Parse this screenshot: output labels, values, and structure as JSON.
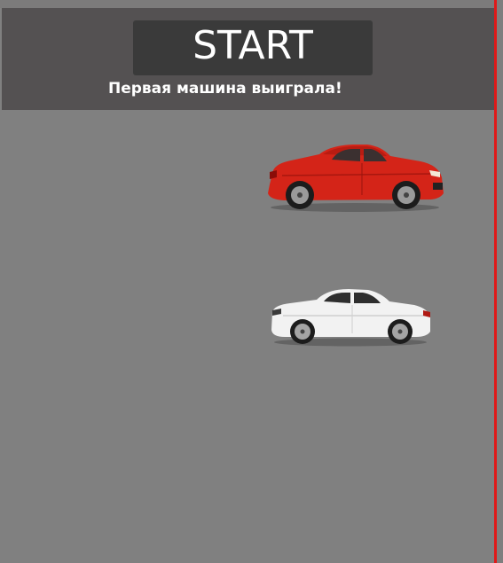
{
  "controls": {
    "start_label": "START"
  },
  "status": {
    "message": "Первая машина выиграла!"
  },
  "colors": {
    "background": "#808080",
    "header_panel": "#545152",
    "start_button": "#3a3a3a",
    "finish_line": "#e01818"
  },
  "cars": [
    {
      "name": "red-coupe",
      "color": "#d42418"
    },
    {
      "name": "white-sedan",
      "color": "#f2f2f2"
    }
  ]
}
